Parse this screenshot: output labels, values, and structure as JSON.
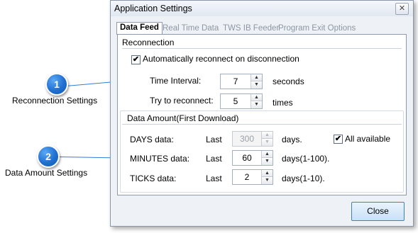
{
  "callouts": [
    {
      "number": "1",
      "label": "Reconnection Settings"
    },
    {
      "number": "2",
      "label": "Data Amount Settings"
    }
  ],
  "window": {
    "title": "Application Settings",
    "close_glyph": "✕"
  },
  "tabs": [
    {
      "label": "Data Feed",
      "active": true
    },
    {
      "label": "Real Time Data",
      "active": false
    },
    {
      "label": "TWS IB Feeder",
      "active": false
    },
    {
      "label": "Program Exit Options",
      "active": false
    }
  ],
  "reconnection": {
    "title": "Reconnection",
    "auto_reconnect_label": "Automatically reconnect on disconnection",
    "auto_reconnect_checked": true,
    "time_interval_label": "Time Interval:",
    "time_interval_value": "7",
    "time_interval_unit": "seconds",
    "try_label": "Try to reconnect:",
    "try_value": "5",
    "try_unit": "times"
  },
  "data_amount": {
    "title": "Data Amount(First Download)",
    "days_label": "DAYS data:",
    "days_last": "Last",
    "days_value": "300",
    "days_unit": "days.",
    "all_available_label": "All available",
    "all_available_checked": true,
    "minutes_label": "MINUTES data:",
    "minutes_last": "Last",
    "minutes_value": "60",
    "minutes_unit": "days(1-100).",
    "ticks_label": "TICKS data:",
    "ticks_last": "Last",
    "ticks_value": "2",
    "ticks_unit": "days(1-10)."
  },
  "footer": {
    "close_label": "Close"
  },
  "icons": {
    "check": "✔",
    "spin_up": "▲",
    "spin_down": "▼"
  },
  "colors": {
    "accent": "#1f6fd1",
    "callout_line": "#2f7fd6"
  }
}
